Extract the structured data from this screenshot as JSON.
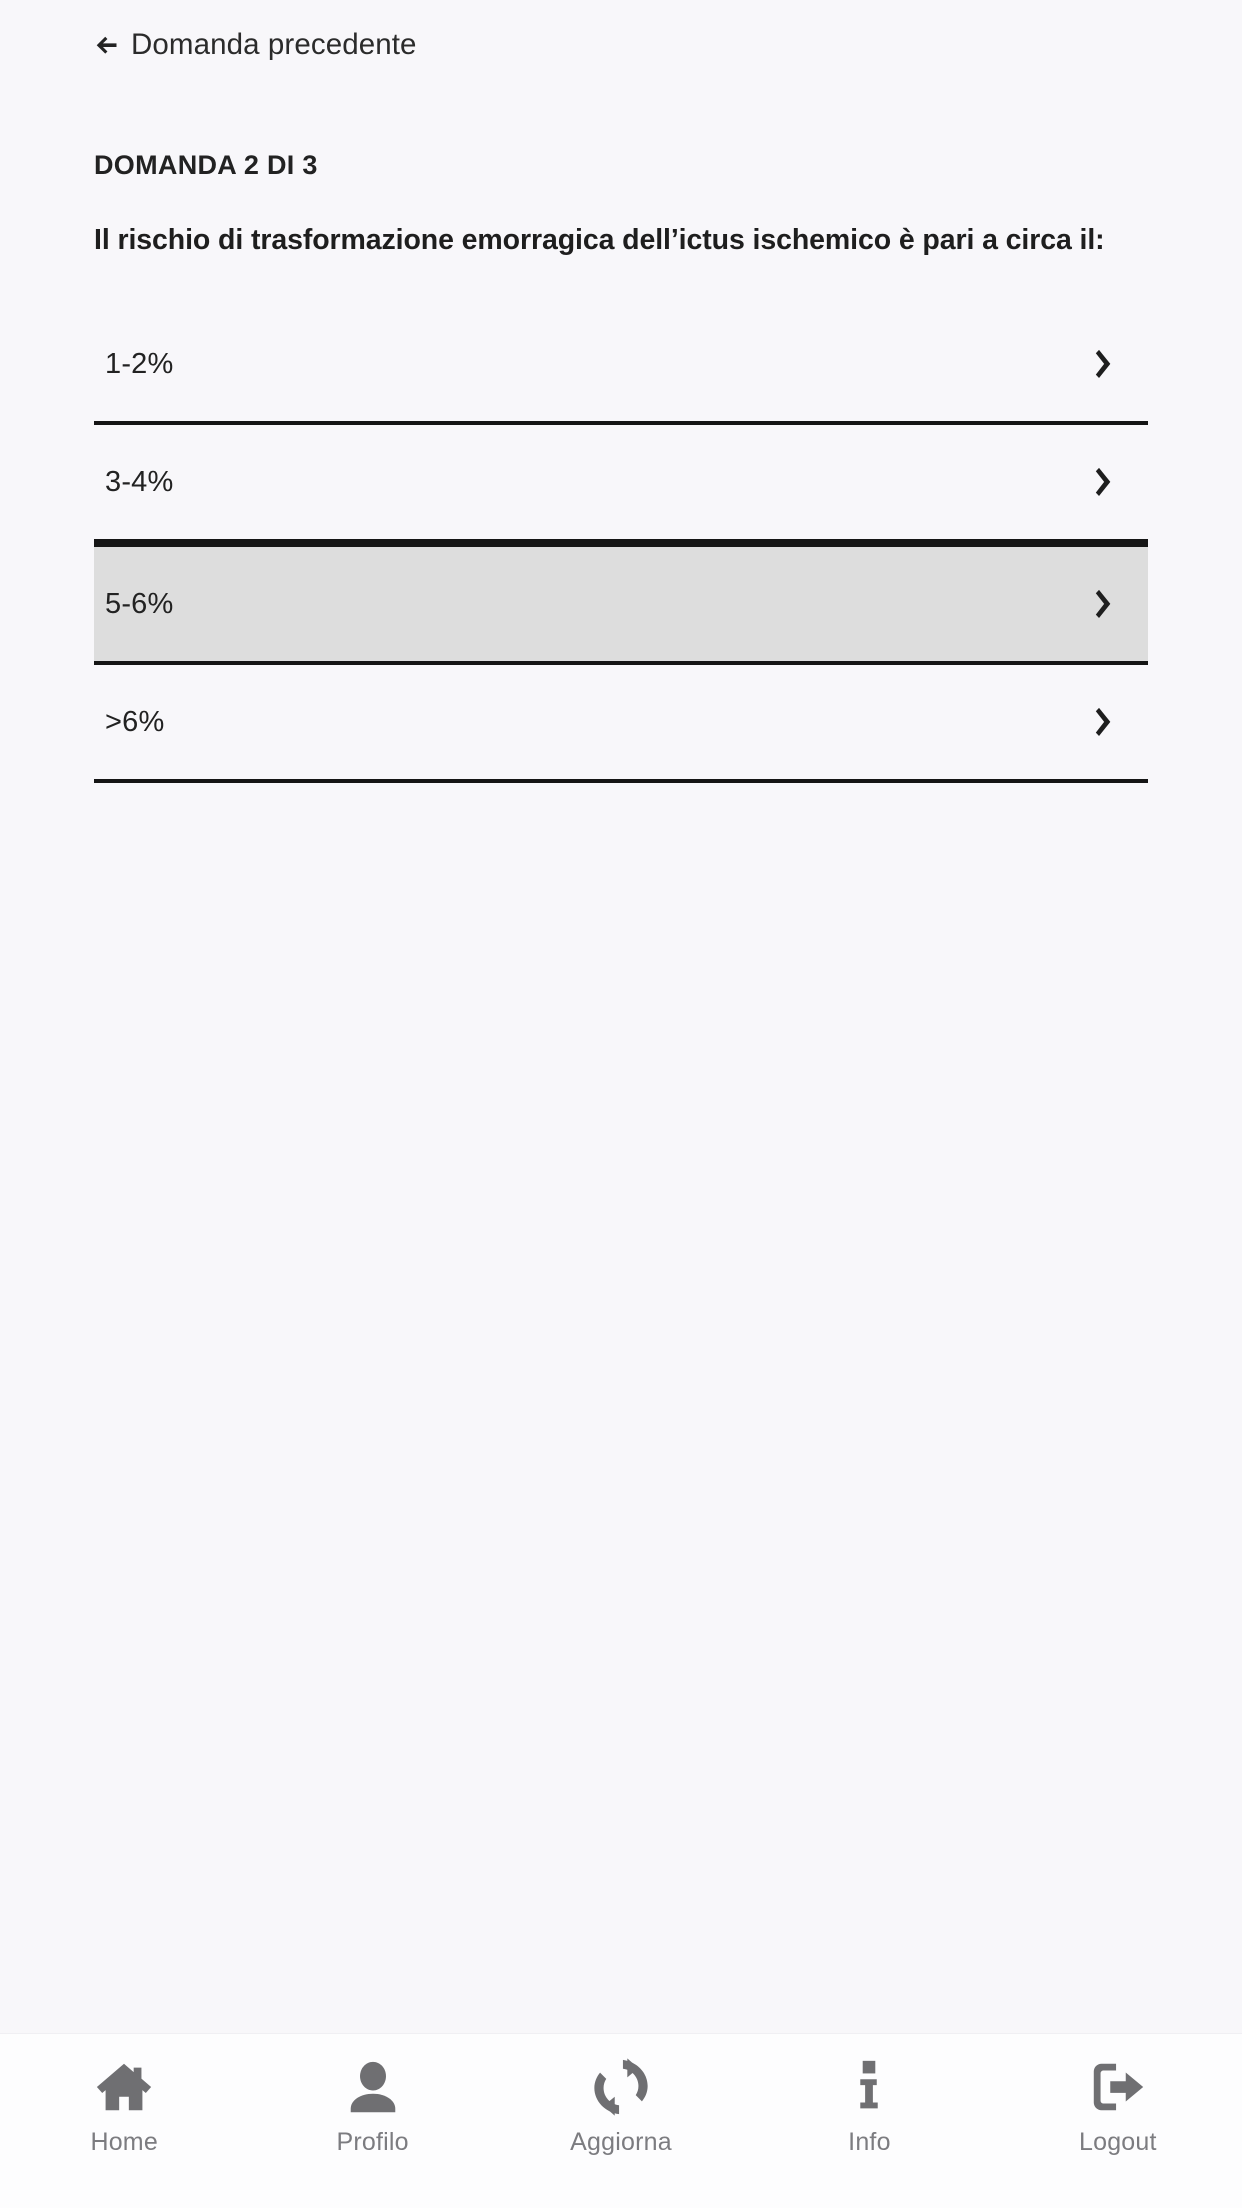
{
  "colors": {
    "page_background": "#f8f7fa",
    "text_primary": "#222222",
    "separator": "#151515",
    "selected_row_background": "#dddddd",
    "nav_background": "#fdfdfe",
    "nav_icon": "#6f6f72",
    "nav_label": "#7c7c80"
  },
  "header": {
    "back_link_label": "Domanda precedente",
    "back_icon": "arrow-left-icon"
  },
  "quiz": {
    "counter_label": "DOMANDA 2 DI 3",
    "question_text": "Il rischio di trasformazione emorragica dell’ictus ischemico è pari a circa il:",
    "options": [
      {
        "label": "1-2%",
        "selected": false,
        "chevron": "chevron-right-icon"
      },
      {
        "label": "3-4%",
        "selected": false,
        "chevron": "chevron-right-icon"
      },
      {
        "label": "5-6%",
        "selected": true,
        "chevron": "chevron-right-icon"
      },
      {
        "label": ">6%",
        "selected": false,
        "chevron": "chevron-right-icon"
      }
    ]
  },
  "bottom_nav": {
    "items": [
      {
        "label": "Home",
        "icon": "home-icon"
      },
      {
        "label": "Profilo",
        "icon": "user-icon"
      },
      {
        "label": "Aggiorna",
        "icon": "refresh-icon"
      },
      {
        "label": "Info",
        "icon": "info-icon"
      },
      {
        "label": "Logout",
        "icon": "logout-icon"
      }
    ]
  }
}
